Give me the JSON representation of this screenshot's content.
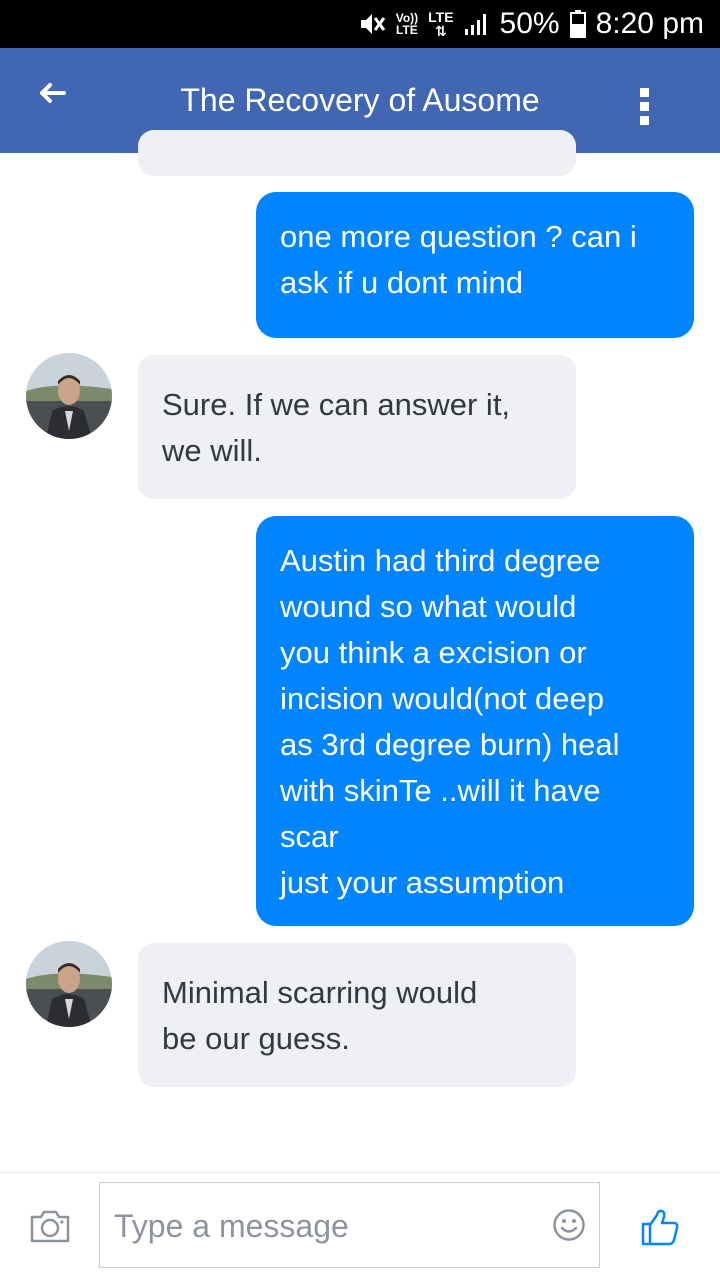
{
  "status_bar": {
    "volte": "Vo))",
    "lte_top": "LTE",
    "lte_label": "LTE",
    "battery": "50%",
    "time": "8:20 pm",
    "icons": [
      "mute-icon",
      "volte-icon",
      "lte-icon",
      "signal-icon",
      "battery-icon"
    ]
  },
  "header": {
    "title": "The Recovery of Ausome",
    "back_icon": "back-arrow-icon",
    "menu_icon": "more-vertical-icon",
    "bg_color": "#4267b2"
  },
  "messages": [
    {
      "from": "me",
      "text": "one more question ? can i\nask if u dont mind"
    },
    {
      "from": "them",
      "text": "Sure. If we can answer it,\nwe will."
    },
    {
      "from": "me",
      "text": "Austin had third degree\nwound so what would\nyou think a excision or\nincision would(not deep\nas 3rd degree burn) heal\nwith skinTe ..will it have\nscar\njust your assumption"
    },
    {
      "from": "them",
      "text": "Minimal scarring would\nbe our guess."
    }
  ],
  "composer": {
    "placeholder": "Type a message",
    "camera_icon": "camera-icon",
    "emoji_icon": "emoji-icon",
    "like_icon": "thumbs-up-icon"
  },
  "colors": {
    "outgoing": "#0084ff",
    "incoming": "#eef0f3",
    "accent": "#0084ff"
  }
}
